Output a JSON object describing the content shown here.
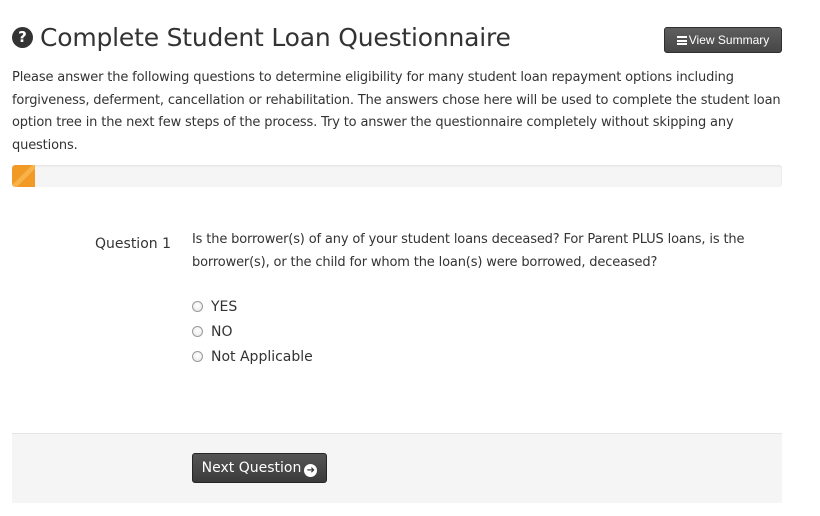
{
  "header": {
    "title": "Complete Student Loan Questionnaire",
    "help_icon": "question-circle-icon",
    "summary_button": "View Summary",
    "summary_icon": "list-icon"
  },
  "intro": {
    "text": "Please answer the following questions to determine eligibility for many student loan repayment options including forgiveness, deferment, cancellation or rehabilitation. The answers chose here will be used to complete the student loan option tree in the next few steps of the process. Try to answer the questionnaire completely without skipping any questions."
  },
  "progress": {
    "fraction": 0.03,
    "color": "#f29a26"
  },
  "question": {
    "label": "Question 1",
    "text": "Is the borrower(s) of any of your student loans deceased? For Parent PLUS loans, is the borrower(s), or the child for whom the loan(s) were borrowed, deceased?",
    "options": [
      {
        "label": "YES"
      },
      {
        "label": "NO"
      },
      {
        "label": "Not Applicable"
      }
    ]
  },
  "footer": {
    "next_button": "Next Question",
    "next_icon": "arrow-circle-right-icon"
  }
}
